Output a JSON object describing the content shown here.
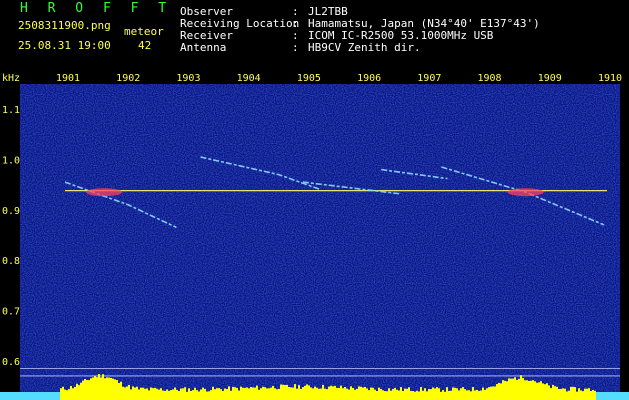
{
  "header": {
    "app_title": "H R O F F T",
    "filename": "2508311900.png",
    "datetime": "25.08.31 19:00",
    "meteor_label": "meteor",
    "meteor_count": "42",
    "info_rows": [
      {
        "label": "Observer",
        "sep": ":",
        "value": "JL2TBB"
      },
      {
        "label": "Receiving Location",
        "sep": ":",
        "value": "Hamamatsu, Japan (N34°40' E137°43')"
      },
      {
        "label": "Receiver",
        "sep": ":",
        "value": "ICOM IC-R2500 53.1000MHz USB"
      },
      {
        "label": "Antenna",
        "sep": ":",
        "value": "HB9CV Zenith dir."
      }
    ]
  },
  "chart_data": {
    "type": "heatmap",
    "ylabel": "kHz",
    "x_ticks": [
      "1901",
      "1902",
      "1903",
      "1904",
      "1905",
      "1906",
      "1907",
      "1908",
      "1909",
      "1910"
    ],
    "x_range": [
      1901,
      1910
    ],
    "y_ticks": [
      "1.1",
      "1.0",
      "0.9",
      "0.8",
      "0.7",
      "0.6"
    ],
    "y_range": [
      0.55,
      1.15
    ],
    "carrier_khz": 0.938,
    "traces": [
      {
        "points": [
          [
            1900.95,
            0.955
          ],
          [
            1902.0,
            0.91
          ],
          [
            1902.8,
            0.865
          ]
        ]
      },
      {
        "points": [
          [
            1903.2,
            1.005
          ],
          [
            1904.5,
            0.97
          ],
          [
            1905.2,
            0.94
          ]
        ]
      },
      {
        "points": [
          [
            1904.9,
            0.955
          ],
          [
            1906.5,
            0.932
          ]
        ]
      },
      {
        "points": [
          [
            1906.2,
            0.98
          ],
          [
            1907.3,
            0.962
          ]
        ]
      },
      {
        "points": [
          [
            1907.2,
            0.985
          ],
          [
            1908.6,
            0.935
          ],
          [
            1909.9,
            0.87
          ]
        ]
      }
    ],
    "colors": {
      "background": "#08147a",
      "carrier": "#ffff66",
      "trace": "#8fd8ff",
      "hot": "#ff4060",
      "spectrum": "#ffff00"
    }
  }
}
